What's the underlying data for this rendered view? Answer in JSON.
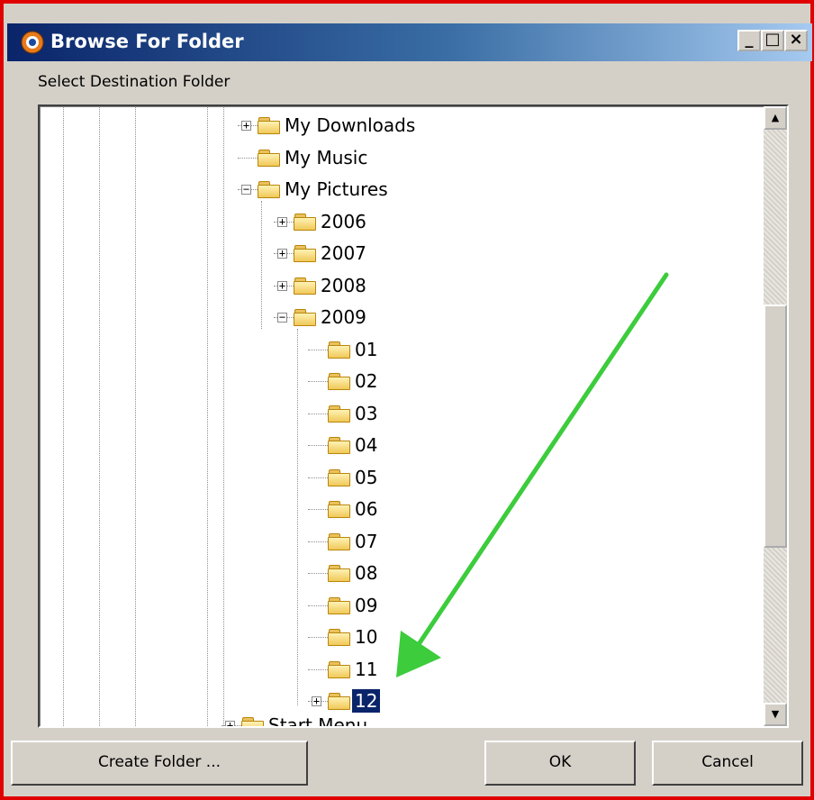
{
  "window": {
    "title": "Browse For Folder",
    "controls": [
      "_",
      "□",
      "×"
    ]
  },
  "dialog": {
    "prompt": "Select Destination Folder"
  },
  "tree": {
    "items": [
      {
        "label": "My Downloads",
        "toggle": "+"
      },
      {
        "label": "My Music",
        "toggle": ""
      },
      {
        "label": "My Pictures",
        "toggle": "−"
      },
      {
        "label": "2006",
        "toggle": "+"
      },
      {
        "label": "2007",
        "toggle": "+"
      },
      {
        "label": "2008",
        "toggle": "+"
      },
      {
        "label": "2009",
        "toggle": "−"
      },
      {
        "label": "01",
        "toggle": ""
      },
      {
        "label": "02",
        "toggle": ""
      },
      {
        "label": "03",
        "toggle": ""
      },
      {
        "label": "04",
        "toggle": ""
      },
      {
        "label": "05",
        "toggle": ""
      },
      {
        "label": "06",
        "toggle": ""
      },
      {
        "label": "07",
        "toggle": ""
      },
      {
        "label": "08",
        "toggle": ""
      },
      {
        "label": "09",
        "toggle": ""
      },
      {
        "label": "10",
        "toggle": ""
      },
      {
        "label": "11",
        "toggle": ""
      },
      {
        "label": "12",
        "toggle": "+",
        "selected": true
      },
      {
        "label": "Start Menu",
        "toggle": "+"
      }
    ]
  },
  "buttons": {
    "create_folder": "Create Folder ...",
    "ok": "OK",
    "cancel": "Cancel"
  },
  "colors": {
    "frame_border": "#e00000",
    "selection": "#0a246a",
    "arrow": "#3ccc3c"
  }
}
